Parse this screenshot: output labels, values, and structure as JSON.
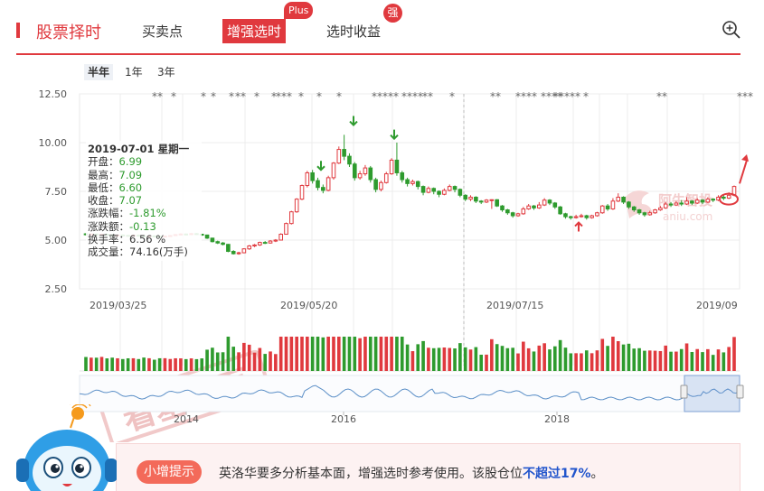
{
  "header": {
    "title": "股票择时",
    "tabs": [
      "买卖点",
      "增强选时",
      "选时收益"
    ],
    "active_tab": "增强选时",
    "plus_badge": "Plus",
    "strong_badge": "强",
    "zoom_icon": "zoom-in-icon"
  },
  "periods": [
    "半年",
    "1年",
    "3年"
  ],
  "active_period": "半年",
  "tooltip": {
    "date": "2019-07-01 星期一",
    "open_label": "开盘：",
    "open": "6.99",
    "high_label": "最高：",
    "high": "7.09",
    "low_label": "最低：",
    "low": "6.60",
    "close_label": "收盘：",
    "close": "7.07",
    "chg_pct_label": "涨跌幅：",
    "chg_pct": "-1.81%",
    "chg_label": "涨跌额：",
    "chg": "-0.13",
    "turnover_label": "换手率：",
    "turnover": "6.56 %",
    "volume_label": "成交量：",
    "volume": "74.16(万手)"
  },
  "watermark": {
    "stamp": "看基本面",
    "brand_cn": "阿牛智投",
    "brand_url": "aniu.com"
  },
  "banner": {
    "pill": "小增提示",
    "text_before": "英洛华要多分析基本面，增强选时参考使用。该股仓位",
    "text_highlight": "不超过17%",
    "text_after": "。"
  },
  "colors": {
    "up": "#e0393e",
    "down": "#2e9b2e",
    "accent": "#e0393e",
    "nav": "#5b8fc7"
  },
  "chart_data": {
    "type": "candlestick",
    "y_ticks": [
      "12.50",
      "10.00",
      "7.50",
      "5.00",
      "2.50"
    ],
    "ylim": [
      2.5,
      12.5
    ],
    "x_tick_labels": [
      "2019/03/25",
      "2019/05/20",
      "2019/07/15",
      "2019/09"
    ],
    "nav_year_labels": [
      "2014",
      "2016",
      "2018"
    ],
    "star_groups": [
      "**",
      "*",
      "*",
      "*",
      "*",
      "*",
      "*",
      "*",
      "*****",
      "****",
      "**",
      "*",
      "**",
      "****",
      "****",
      "*****",
      "*",
      "**",
      "***",
      "*",
      "**",
      "***",
      "*"
    ],
    "sell_arrow_dates": [
      "2019-05-20",
      "2019-05-27",
      "2019-06-11"
    ],
    "buy_arrow_dates": [
      "2019-07-31",
      "2019-09-20"
    ],
    "candles": [
      [
        5.32,
        5.28,
        5.36,
        5.24
      ],
      [
        5.28,
        5.31,
        5.35,
        5.24
      ],
      [
        5.31,
        5.26,
        5.33,
        5.22
      ],
      [
        5.26,
        5.3,
        5.34,
        5.22
      ],
      [
        5.3,
        5.27,
        5.33,
        5.23
      ],
      [
        5.27,
        5.23,
        5.3,
        5.19
      ],
      [
        5.23,
        5.26,
        5.29,
        5.19
      ],
      [
        5.26,
        5.24,
        5.29,
        5.2
      ],
      [
        5.24,
        5.21,
        5.27,
        5.17
      ],
      [
        5.21,
        5.25,
        5.28,
        5.18
      ],
      [
        5.25,
        5.22,
        5.28,
        5.19
      ],
      [
        5.22,
        5.18,
        5.25,
        5.14
      ],
      [
        5.18,
        5.21,
        5.24,
        5.14
      ],
      [
        5.21,
        5.2,
        5.24,
        5.16
      ],
      [
        5.2,
        5.17,
        5.23,
        5.13
      ],
      [
        5.17,
        5.2,
        5.23,
        5.13
      ],
      [
        5.2,
        5.23,
        5.26,
        5.17
      ],
      [
        5.23,
        5.28,
        5.31,
        5.21
      ],
      [
        5.28,
        5.31,
        5.35,
        5.25
      ],
      [
        5.31,
        5.29,
        5.34,
        5.25
      ],
      [
        5.29,
        5.33,
        5.36,
        5.26
      ],
      [
        5.33,
        5.3,
        5.36,
        5.27
      ],
      [
        5.3,
        5.26,
        5.32,
        5.22
      ],
      [
        5.26,
        5.1,
        5.28,
        5.06
      ],
      [
        5.1,
        4.92,
        5.12,
        4.88
      ],
      [
        4.92,
        4.85,
        4.97,
        4.8
      ],
      [
        4.85,
        4.78,
        4.9,
        4.73
      ],
      [
        4.78,
        4.42,
        4.8,
        4.38
      ],
      [
        4.42,
        4.3,
        4.48,
        4.26
      ],
      [
        4.3,
        4.35,
        4.4,
        4.25
      ],
      [
        4.35,
        4.55,
        4.58,
        4.32
      ],
      [
        4.55,
        4.7,
        4.75,
        4.5
      ],
      [
        4.7,
        4.75,
        4.8,
        4.64
      ],
      [
        4.75,
        4.88,
        4.92,
        4.7
      ],
      [
        4.88,
        4.85,
        4.95,
        4.8
      ],
      [
        4.85,
        4.95,
        5.0,
        4.82
      ],
      [
        4.95,
        5.0,
        5.05,
        4.9
      ],
      [
        5.0,
        5.3,
        5.35,
        4.98
      ],
      [
        5.3,
        5.85,
        5.9,
        5.28
      ],
      [
        5.85,
        6.45,
        6.5,
        5.8
      ],
      [
        6.45,
        7.1,
        7.15,
        6.4
      ],
      [
        7.1,
        7.8,
        7.85,
        7.05
      ],
      [
        7.8,
        8.45,
        8.55,
        7.7
      ],
      [
        8.45,
        8.05,
        8.6,
        7.9
      ],
      [
        8.05,
        7.7,
        8.2,
        7.55
      ],
      [
        7.7,
        7.55,
        7.85,
        7.4
      ],
      [
        7.55,
        8.2,
        8.3,
        7.5
      ],
      [
        8.2,
        8.95,
        9.0,
        8.1
      ],
      [
        8.95,
        9.65,
        9.8,
        8.9
      ],
      [
        9.65,
        9.3,
        10.4,
        9.1
      ],
      [
        9.3,
        8.9,
        9.45,
        8.75
      ],
      [
        8.9,
        8.2,
        9.0,
        8.05
      ],
      [
        8.2,
        8.4,
        8.55,
        8.1
      ],
      [
        8.4,
        8.7,
        8.85,
        8.3
      ],
      [
        8.7,
        8.1,
        8.8,
        7.95
      ],
      [
        8.1,
        7.6,
        8.2,
        7.45
      ],
      [
        7.6,
        7.95,
        8.05,
        7.5
      ],
      [
        7.95,
        8.4,
        8.5,
        7.9
      ],
      [
        8.4,
        9.1,
        9.2,
        8.35
      ],
      [
        9.1,
        8.45,
        10.0,
        8.3
      ],
      [
        8.45,
        8.1,
        8.55,
        7.95
      ],
      [
        8.1,
        7.9,
        8.2,
        7.75
      ],
      [
        7.9,
        8.0,
        8.1,
        7.8
      ],
      [
        8.0,
        7.75,
        8.05,
        7.6
      ],
      [
        7.75,
        7.45,
        7.8,
        7.3
      ],
      [
        7.45,
        7.65,
        7.75,
        7.4
      ],
      [
        7.65,
        7.5,
        7.7,
        7.35
      ],
      [
        7.5,
        7.35,
        7.55,
        7.2
      ],
      [
        7.35,
        7.55,
        7.65,
        7.3
      ],
      [
        7.55,
        7.75,
        7.85,
        7.5
      ],
      [
        7.75,
        7.6,
        7.8,
        7.45
      ],
      [
        7.6,
        7.3,
        7.65,
        7.2
      ],
      [
        7.3,
        7.1,
        7.35,
        7.0
      ],
      [
        7.1,
        7.2,
        7.3,
        7.0
      ],
      [
        7.2,
        7.0,
        7.25,
        6.9
      ],
      [
        7.0,
        6.95,
        7.05,
        6.85
      ],
      [
        6.95,
        7.05,
        7.1,
        6.9
      ],
      [
        7.05,
        7.07,
        7.09,
        6.6
      ],
      [
        7.07,
        6.75,
        7.1,
        6.7
      ],
      [
        6.75,
        6.55,
        6.8,
        6.45
      ],
      [
        6.55,
        6.4,
        6.6,
        6.3
      ],
      [
        6.4,
        6.25,
        6.45,
        6.15
      ],
      [
        6.25,
        6.35,
        6.4,
        6.2
      ],
      [
        6.35,
        6.6,
        6.7,
        6.3
      ],
      [
        6.6,
        6.75,
        6.85,
        6.55
      ],
      [
        6.75,
        6.65,
        6.8,
        6.55
      ],
      [
        6.65,
        6.8,
        6.95,
        6.6
      ],
      [
        6.8,
        7.05,
        7.15,
        6.75
      ],
      [
        7.05,
        6.9,
        7.1,
        6.8
      ],
      [
        6.9,
        6.7,
        6.95,
        6.6
      ],
      [
        6.7,
        6.35,
        6.75,
        6.3
      ],
      [
        6.35,
        6.2,
        6.4,
        6.1
      ],
      [
        6.2,
        6.15,
        6.25,
        6.05
      ],
      [
        6.15,
        6.2,
        6.3,
        6.1
      ],
      [
        6.2,
        6.25,
        6.35,
        6.15
      ],
      [
        6.25,
        6.15,
        6.3,
        6.05
      ],
      [
        6.15,
        6.25,
        6.3,
        6.1
      ],
      [
        6.25,
        6.4,
        6.45,
        6.2
      ],
      [
        6.4,
        6.75,
        6.8,
        6.35
      ],
      [
        6.75,
        6.6,
        6.85,
        6.5
      ],
      [
        6.6,
        7.0,
        7.15,
        6.55
      ],
      [
        7.0,
        7.2,
        7.4,
        6.95
      ],
      [
        7.2,
        6.95,
        7.25,
        6.85
      ],
      [
        6.95,
        6.7,
        7.0,
        6.6
      ],
      [
        6.7,
        6.55,
        6.75,
        6.45
      ],
      [
        6.55,
        6.4,
        6.6,
        6.3
      ],
      [
        6.4,
        6.3,
        6.45,
        6.2
      ],
      [
        6.3,
        6.4,
        6.5,
        6.25
      ],
      [
        6.4,
        6.55,
        6.6,
        6.35
      ],
      [
        6.55,
        6.65,
        6.75,
        6.5
      ],
      [
        6.65,
        6.85,
        6.95,
        6.6
      ],
      [
        6.85,
        6.8,
        6.95,
        6.7
      ],
      [
        6.8,
        6.9,
        7.0,
        6.75
      ],
      [
        6.9,
        6.85,
        7.05,
        6.75
      ],
      [
        6.85,
        7.0,
        7.2,
        6.8
      ],
      [
        7.0,
        6.9,
        7.05,
        6.8
      ],
      [
        6.9,
        7.05,
        7.15,
        6.85
      ],
      [
        7.05,
        6.95,
        7.1,
        6.85
      ],
      [
        6.95,
        7.1,
        7.2,
        6.9
      ],
      [
        7.1,
        7.05,
        7.15,
        6.95
      ],
      [
        7.05,
        7.2,
        7.3,
        7.0
      ],
      [
        7.2,
        7.15,
        7.3,
        7.05
      ],
      [
        7.15,
        7.3,
        7.45,
        7.1
      ],
      [
        7.3,
        7.75,
        7.8,
        7.25
      ]
    ]
  }
}
